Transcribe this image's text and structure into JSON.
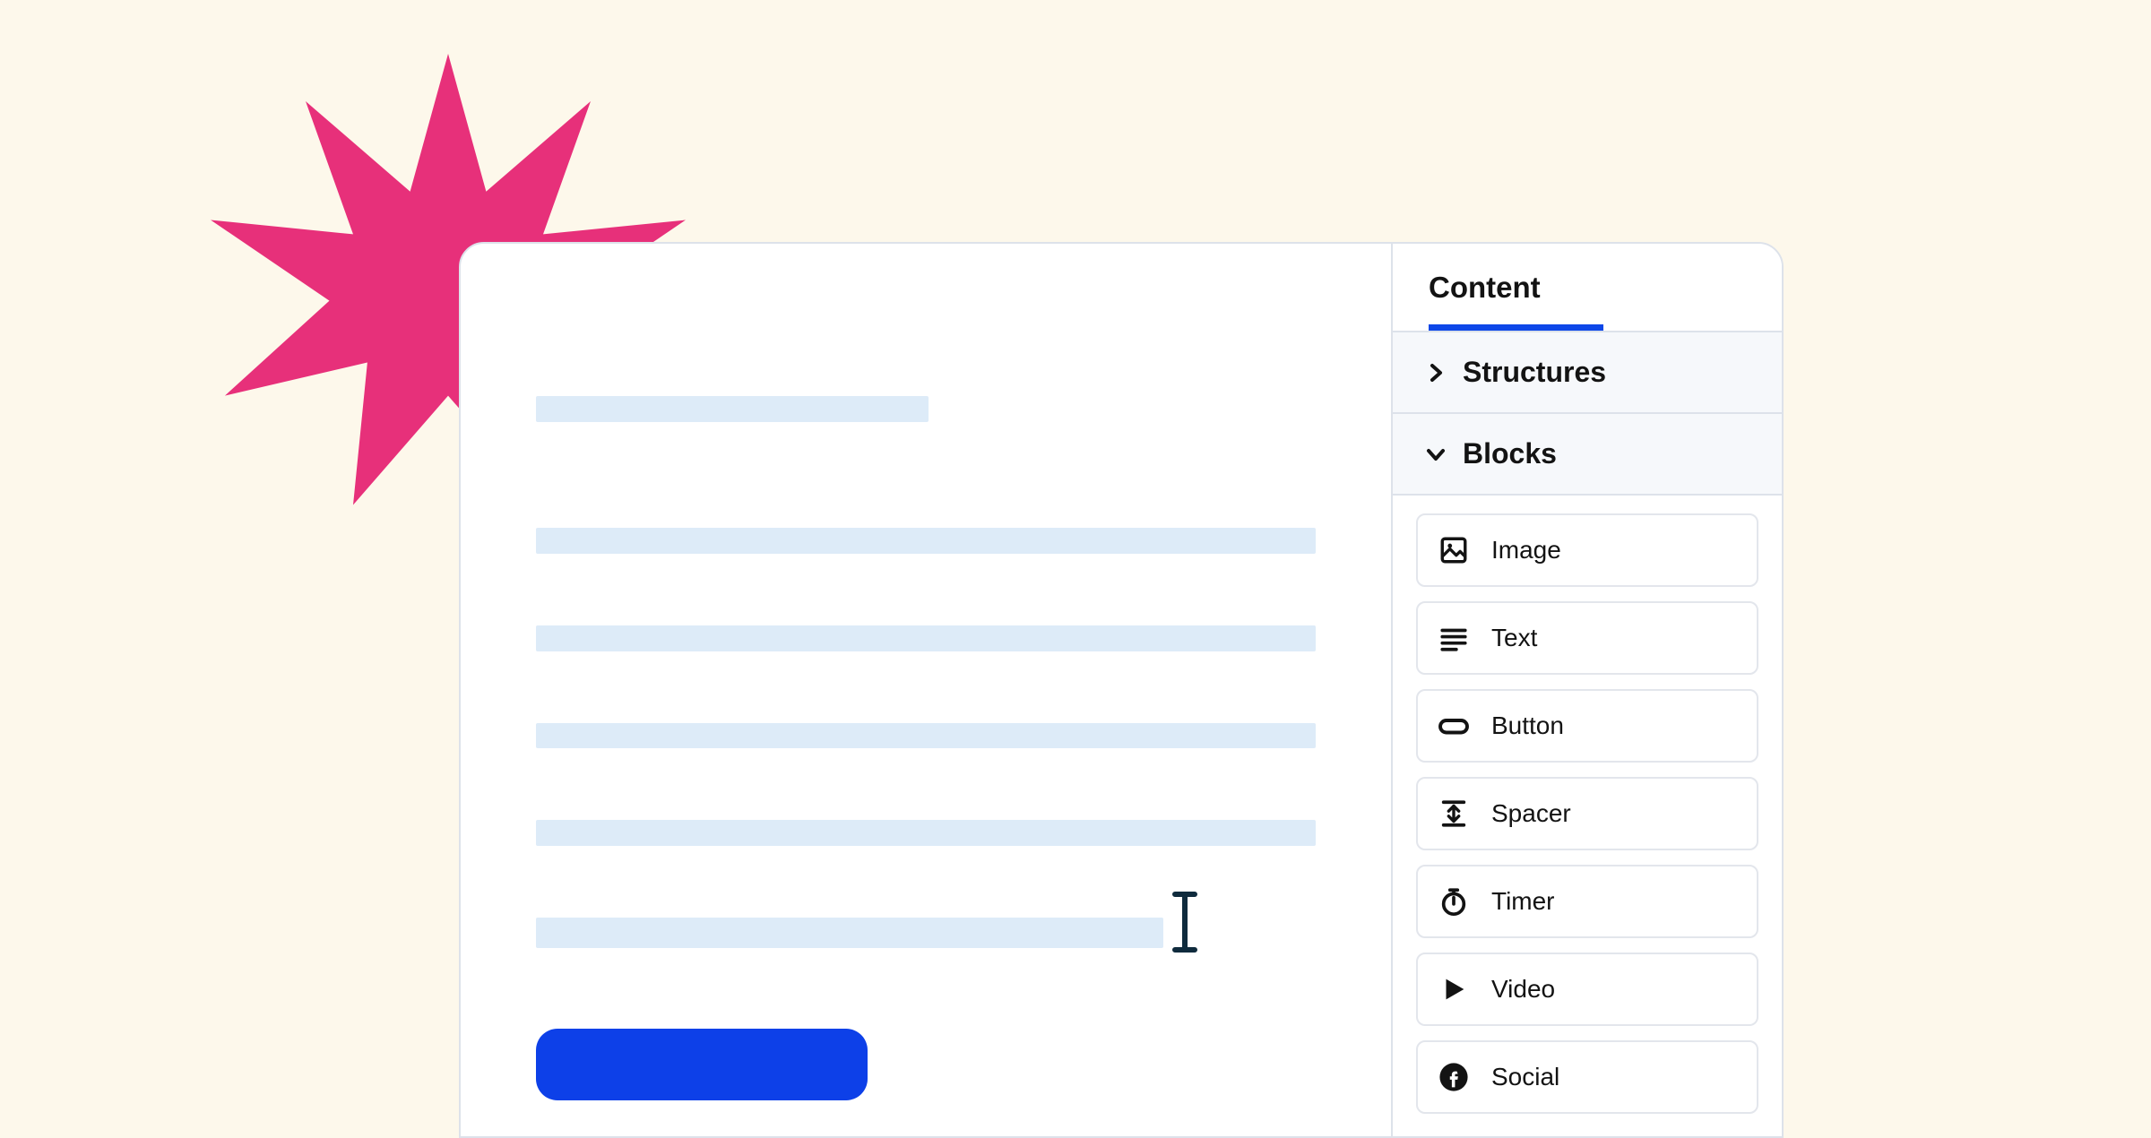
{
  "colors": {
    "accent": "#0D40E8",
    "starburst": "#E7307A",
    "skeleton": "#DDEBF8",
    "background": "#FDF8EB",
    "border": "#DDE2EA"
  },
  "sidebar": {
    "tab_label": "Content",
    "sections": {
      "structures": {
        "label": "Structures",
        "expanded": false
      },
      "blocks": {
        "label": "Blocks",
        "expanded": true
      }
    },
    "blocks": [
      {
        "icon": "image-icon",
        "label": "Image"
      },
      {
        "icon": "text-icon",
        "label": "Text"
      },
      {
        "icon": "button-icon",
        "label": "Button"
      },
      {
        "icon": "spacer-icon",
        "label": "Spacer"
      },
      {
        "icon": "timer-icon",
        "label": "Timer"
      },
      {
        "icon": "video-icon",
        "label": "Video"
      },
      {
        "icon": "social-icon",
        "label": "Social"
      }
    ]
  }
}
